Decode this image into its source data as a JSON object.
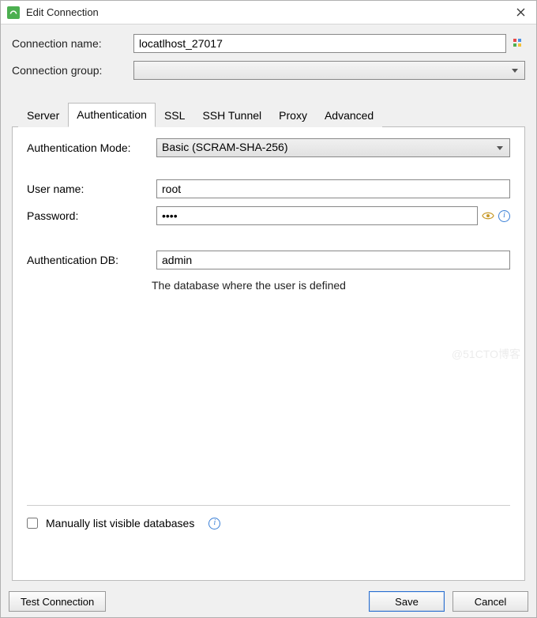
{
  "titlebar": {
    "title": "Edit Connection"
  },
  "fields": {
    "connection_name_label": "Connection name:",
    "connection_name_value": "locatlhost_27017",
    "connection_group_label": "Connection group:",
    "connection_group_value": ""
  },
  "tabs": [
    {
      "label": "Server",
      "active": false
    },
    {
      "label": "Authentication",
      "active": true
    },
    {
      "label": "SSL",
      "active": false
    },
    {
      "label": "SSH Tunnel",
      "active": false
    },
    {
      "label": "Proxy",
      "active": false
    },
    {
      "label": "Advanced",
      "active": false
    }
  ],
  "auth_panel": {
    "mode_label": "Authentication Mode:",
    "mode_value": "Basic (SCRAM-SHA-256)",
    "username_label": "User name:",
    "username_value": "root",
    "password_label": "Password:",
    "password_mask": "••••",
    "authdb_label": "Authentication DB:",
    "authdb_value": "admin",
    "authdb_help": "The database where the user is defined",
    "manual_list_label": "Manually list visible databases",
    "manual_list_checked": false
  },
  "footer": {
    "test_label": "Test Connection",
    "save_label": "Save",
    "cancel_label": "Cancel"
  },
  "watermark": "@51CTO博客"
}
